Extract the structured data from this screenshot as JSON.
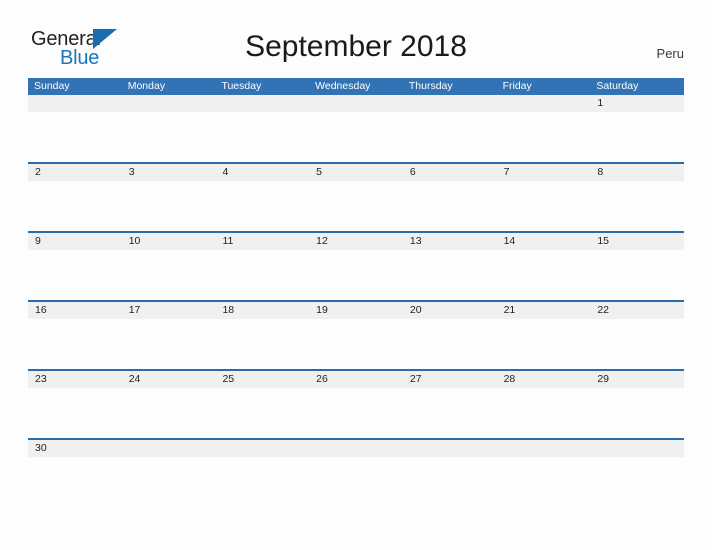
{
  "brand": {
    "word_one": "General",
    "word_two": "Blue",
    "triangle_icon": "triangle-icon",
    "color_dark": "#231f20",
    "color_blue": "#1b75bb"
  },
  "header": {
    "title": "September 2018",
    "country": "Peru"
  },
  "calendar": {
    "header_color": "#3173b5",
    "date_band_color": "#f0f0f0",
    "separator_color": "#2b6ca8",
    "weekdays": [
      "Sunday",
      "Monday",
      "Tuesday",
      "Wednesday",
      "Thursday",
      "Friday",
      "Saturday"
    ],
    "weeks": [
      [
        "",
        "",
        "",
        "",
        "",
        "",
        "1"
      ],
      [
        "2",
        "3",
        "4",
        "5",
        "6",
        "7",
        "8"
      ],
      [
        "9",
        "10",
        "11",
        "12",
        "13",
        "14",
        "15"
      ],
      [
        "16",
        "17",
        "18",
        "19",
        "20",
        "21",
        "22"
      ],
      [
        "23",
        "24",
        "25",
        "26",
        "27",
        "28",
        "29"
      ],
      [
        "30",
        "",
        "",
        "",
        "",
        "",
        ""
      ]
    ]
  }
}
